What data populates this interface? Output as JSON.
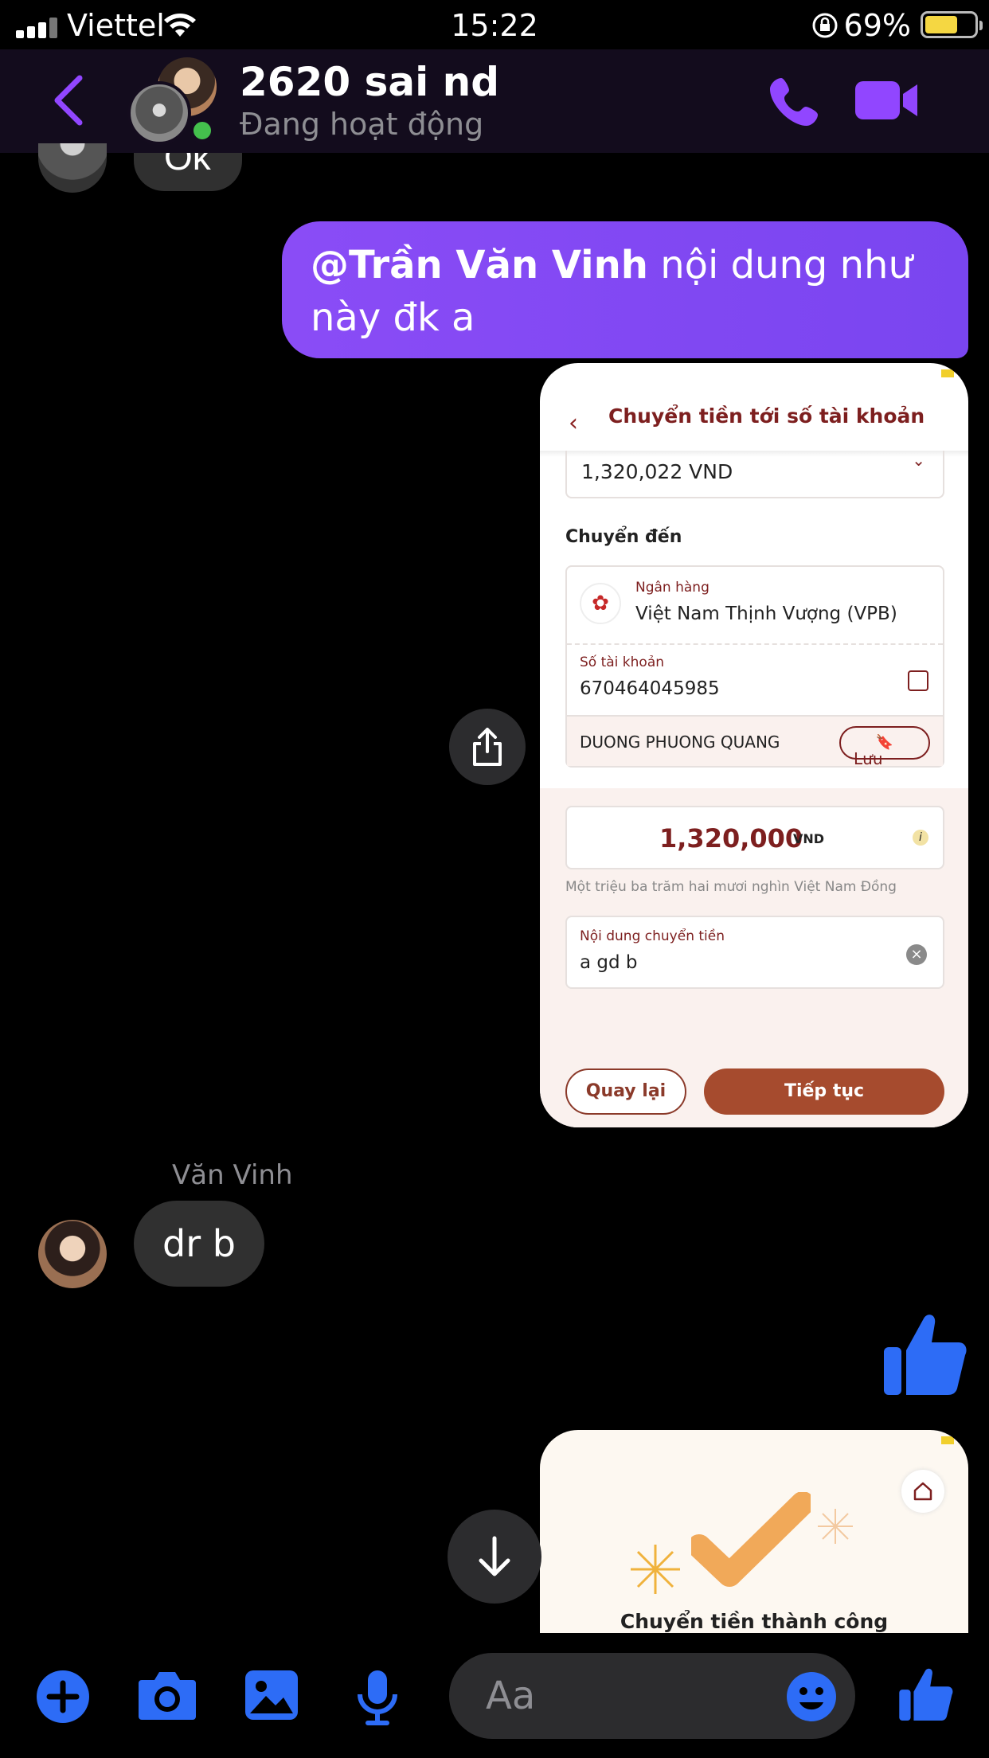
{
  "status_bar": {
    "carrier": "Viettel",
    "time": "15:22",
    "battery_percent": "69%",
    "battery_level": 0.69
  },
  "header": {
    "back_icon": "chevron-left-icon",
    "title": "2620 sai nd",
    "subtitle": "Đang hoạt động",
    "call_icon": "phone-icon",
    "video_icon": "video-camera-icon",
    "accent_color": "#9146FF"
  },
  "messages": {
    "previous_incoming_text": "Ok",
    "outgoing": {
      "mention": "@Trần Văn Vinh",
      "text": " nội dung như này đk a"
    },
    "bank_screenshot": {
      "title": "Chuyển tiền tới số tài khoản",
      "amount_top": "1,320,022 VND",
      "section_label": "Chuyển đến",
      "bank_label": "Ngân hàng",
      "bank_name": "Việt Nam Thịnh Vượng (VPB)",
      "account_label": "Số tài khoản",
      "account_number": "670464045985",
      "recipient_name": "DUONG PHUONG QUANG",
      "save_label": "Lưu",
      "amount": "1,320,000",
      "currency": "VND",
      "amount_words": "Một triệu ba trăm hai mươi nghìn Việt Nam Đồng",
      "note_label": "Nội dung chuyển tiền",
      "note_value": "a gd b",
      "back_label": "Quay lại",
      "continue_label": "Tiếp tục"
    },
    "incoming_sender": "Văn Vinh",
    "incoming_text": "dr b",
    "success_screenshot": {
      "title": "Chuyển tiền thành công"
    }
  },
  "composer": {
    "placeholder": "Aa",
    "icons": [
      "plus-icon",
      "camera-icon",
      "image-icon",
      "microphone-icon",
      "emoji-icon",
      "thumbs-up-icon"
    ],
    "icon_color": "#2D6CF6"
  }
}
